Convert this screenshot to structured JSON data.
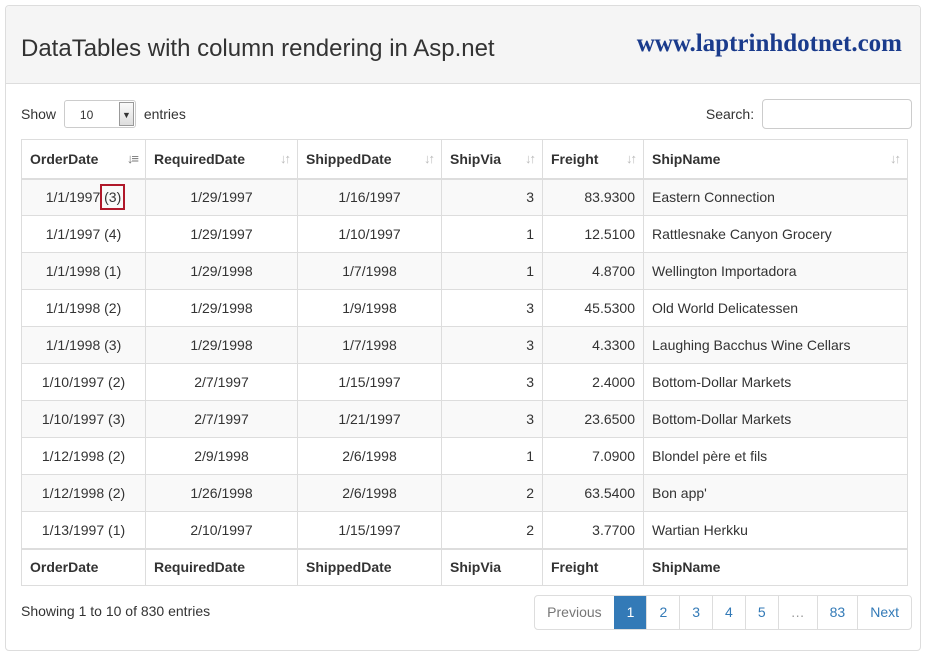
{
  "header": {
    "title": "DataTables with column rendering in Asp.net",
    "brand": "www.laptrinhdotnet.com"
  },
  "length": {
    "show_label": "Show",
    "value": "10",
    "entries_label": "entries"
  },
  "search": {
    "label": "Search:",
    "value": ""
  },
  "columns": [
    "OrderDate",
    "RequiredDate",
    "ShippedDate",
    "ShipVia",
    "Freight",
    "ShipName"
  ],
  "rows": [
    [
      "1/1/1997",
      "(3)",
      "1/29/1997",
      "1/16/1997",
      "3",
      "83.9300",
      "Eastern Connection"
    ],
    [
      "1/1/1997",
      "(4)",
      "1/29/1997",
      "1/10/1997",
      "1",
      "12.5100",
      "Rattlesnake Canyon Grocery"
    ],
    [
      "1/1/1998",
      "(1)",
      "1/29/1998",
      "1/7/1998",
      "1",
      "4.8700",
      "Wellington Importadora"
    ],
    [
      "1/1/1998",
      "(2)",
      "1/29/1998",
      "1/9/1998",
      "3",
      "45.5300",
      "Old World Delicatessen"
    ],
    [
      "1/1/1998",
      "(3)",
      "1/29/1998",
      "1/7/1998",
      "3",
      "4.3300",
      "Laughing Bacchus Wine Cellars"
    ],
    [
      "1/10/1997",
      "(2)",
      "2/7/1997",
      "1/15/1997",
      "3",
      "2.4000",
      "Bottom-Dollar Markets"
    ],
    [
      "1/10/1997",
      "(3)",
      "2/7/1997",
      "1/21/1997",
      "3",
      "23.6500",
      "Bottom-Dollar Markets"
    ],
    [
      "1/12/1998",
      "(2)",
      "2/9/1998",
      "2/6/1998",
      "1",
      "7.0900",
      "Blondel père et fils"
    ],
    [
      "1/12/1998",
      "(2)",
      "1/26/1998",
      "2/6/1998",
      "2",
      "63.5400",
      "Bon app'"
    ],
    [
      "1/13/1997",
      "(1)",
      "2/10/1997",
      "1/15/1997",
      "2",
      "3.7700",
      "Wartian Herkku"
    ]
  ],
  "info": "Showing 1 to 10 of 830 entries",
  "pagination": {
    "previous": "Previous",
    "next": "Next",
    "pages": [
      "1",
      "2",
      "3",
      "4",
      "5",
      "…",
      "83"
    ],
    "active": "1"
  }
}
